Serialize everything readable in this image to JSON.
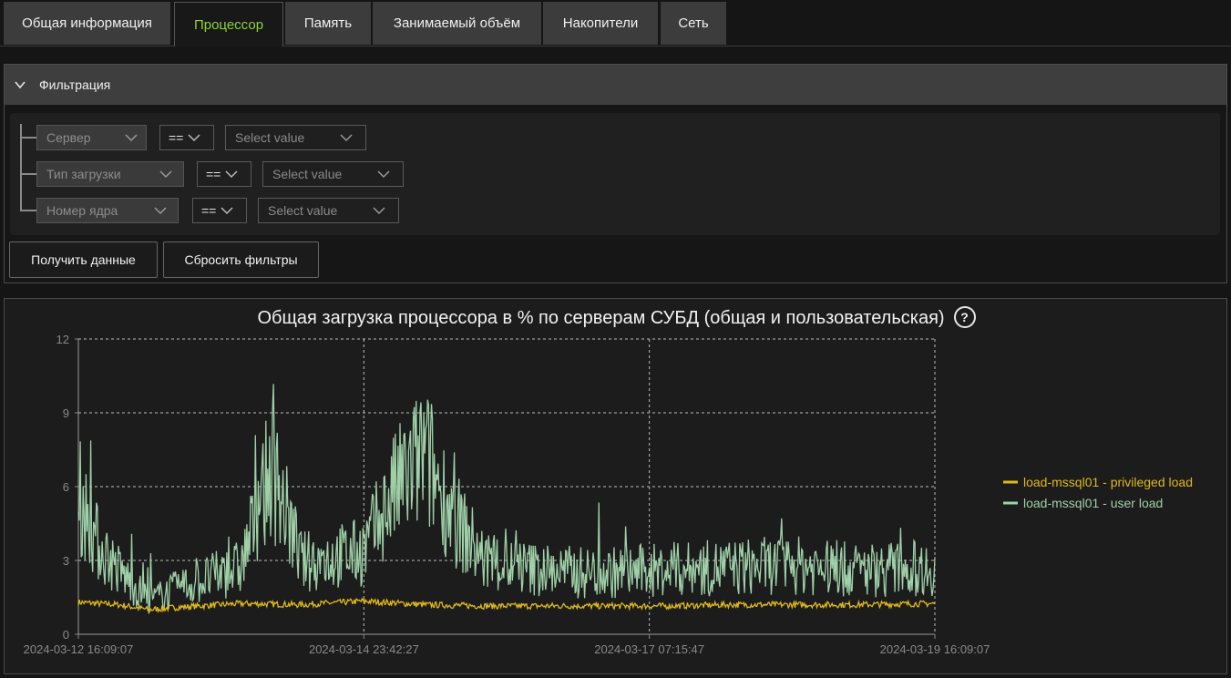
{
  "tabs": [
    {
      "label": "Общая информация",
      "active": false
    },
    {
      "label": "Процессор",
      "active": true
    },
    {
      "label": "Память",
      "active": false
    },
    {
      "label": "Занимаемый объём",
      "active": false
    },
    {
      "label": "Накопители",
      "active": false
    },
    {
      "label": "Сеть",
      "active": false
    }
  ],
  "filter": {
    "title": "Фильтрация",
    "rows": [
      {
        "field": "Сервер",
        "operator": "==",
        "value_placeholder": "Select value"
      },
      {
        "field": "Тип загрузки",
        "operator": "==",
        "value_placeholder": "Select value"
      },
      {
        "field": "Номер ядра",
        "operator": "==",
        "value_placeholder": "Select value"
      }
    ],
    "get_data_label": "Получить данные",
    "reset_label": "Сбросить фильтры"
  },
  "chart_data": {
    "type": "line",
    "title": "Общая загрузка процессора в % по серверам СУБД (общая и пользовательская)",
    "xlabel": "",
    "ylabel": "",
    "x_range": [
      "2024-03-12 16:09:07",
      "2024-03-19 16:09:07"
    ],
    "x_ticks": [
      "2024-03-12 16:09:07",
      "2024-03-14 23:42:27",
      "2024-03-17 07:15:47",
      "2024-03-19 16:09:07"
    ],
    "ylim": [
      0,
      12
    ],
    "y_ticks": [
      0,
      3,
      6,
      9,
      12
    ],
    "grid": true,
    "legend_position": "right",
    "series": [
      {
        "name": "load-mssql01 - privileged load",
        "color": "#e0b81c",
        "x": [
          "2024-03-12 16:09",
          "2024-03-13 00:00",
          "2024-03-13 06:00",
          "2024-03-13 12:00",
          "2024-03-14 00:00",
          "2024-03-14 12:00",
          "2024-03-15 00:00",
          "2024-03-15 12:00",
          "2024-03-16 00:00",
          "2024-03-16 12:00",
          "2024-03-17 00:00",
          "2024-03-17 12:00",
          "2024-03-18 00:00",
          "2024-03-18 12:00",
          "2024-03-19 00:00",
          "2024-03-19 16:09"
        ],
        "values": [
          1.3,
          1.2,
          1.0,
          1.1,
          1.25,
          1.2,
          1.35,
          1.2,
          1.15,
          1.15,
          1.15,
          1.15,
          1.2,
          1.2,
          1.2,
          1.25
        ]
      },
      {
        "name": "load-mssql01 - user load",
        "color": "#9fd0a8",
        "x": [
          "2024-03-12 16:09",
          "2024-03-12 20:00",
          "2024-03-13 00:00",
          "2024-03-13 06:00",
          "2024-03-13 12:00",
          "2024-03-13 18:00",
          "2024-03-14 00:00",
          "2024-03-14 06:00",
          "2024-03-14 12:00",
          "2024-03-14 18:00",
          "2024-03-15 00:00",
          "2024-03-15 06:00",
          "2024-03-15 12:00",
          "2024-03-15 18:00",
          "2024-03-16 00:00",
          "2024-03-16 06:00",
          "2024-03-16 12:00",
          "2024-03-16 18:00",
          "2024-03-17 00:00",
          "2024-03-17 12:00",
          "2024-03-18 00:00",
          "2024-03-18 12:00",
          "2024-03-19 00:00",
          "2024-03-19 16:09"
        ],
        "values": [
          5.5,
          3.5,
          2.5,
          1.3,
          1.8,
          2.2,
          2.6,
          6.5,
          2.8,
          3.0,
          3.2,
          5.5,
          7.0,
          4.5,
          2.8,
          2.6,
          2.5,
          2.4,
          2.4,
          2.5,
          2.6,
          2.7,
          2.5,
          2.6
        ]
      }
    ]
  }
}
